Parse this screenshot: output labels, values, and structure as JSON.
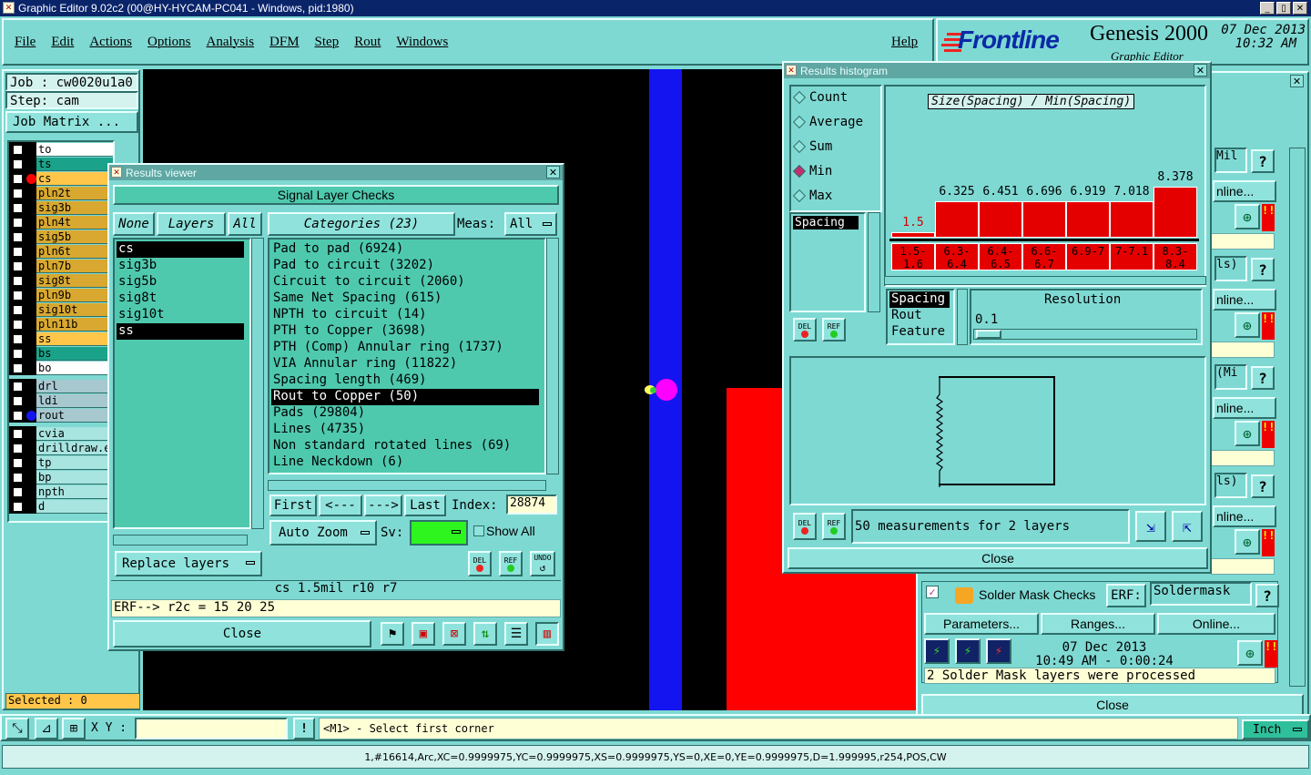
{
  "window": {
    "title": "Graphic Editor 9.02c2 (00@HY-HYCAM-PC041 - Windows, pid:1980)",
    "min": "_",
    "max": "▯",
    "close": "✕"
  },
  "menu": {
    "items": [
      "File",
      "Edit",
      "Actions",
      "Options",
      "Analysis",
      "DFM",
      "Step",
      "Rout",
      "Windows"
    ],
    "help": "Help"
  },
  "brand": {
    "logo": "Frontline",
    "product": "Genesis 2000",
    "subtitle": "Graphic Editor",
    "date": "07 Dec 2013",
    "time": "10:32 AM"
  },
  "job": {
    "job_label": "Job : cw0020u1a0",
    "step_label": "Step: cam",
    "matrix_button": "Job Matrix ..."
  },
  "layers": [
    {
      "name": "to",
      "color": "#ffffff"
    },
    {
      "name": "ts",
      "color": "#1aa38a"
    },
    {
      "name": "cs",
      "color": "#ffc64a"
    },
    {
      "name": "pln2t",
      "color": "#d8a830"
    },
    {
      "name": "sig3b",
      "color": "#d8a830"
    },
    {
      "name": "pln4t",
      "color": "#d8a830"
    },
    {
      "name": "sig5b",
      "color": "#d8a830"
    },
    {
      "name": "pln6t",
      "color": "#d8a830"
    },
    {
      "name": "pln7b",
      "color": "#d8a830"
    },
    {
      "name": "sig8t",
      "color": "#d8a830"
    },
    {
      "name": "pln9b",
      "color": "#d8a830"
    },
    {
      "name": "sig10t",
      "color": "#d8a830"
    },
    {
      "name": "pln11b",
      "color": "#d8a830"
    },
    {
      "name": "ss",
      "color": "#ffc64a"
    },
    {
      "name": "bs",
      "color": "#1aa38a"
    },
    {
      "name": "bo",
      "color": "#ffffff"
    },
    {
      "name": "drl",
      "color": "#a8c8d0"
    },
    {
      "name": "ldi",
      "color": "#a8c8d0"
    },
    {
      "name": "rout",
      "color": "#a8c8d0"
    },
    {
      "name": "cvia",
      "color": "#a8e4e0"
    },
    {
      "name": "drilldraw.e",
      "color": "#a8e4e0"
    },
    {
      "name": "tp",
      "color": "#a8e4e0"
    },
    {
      "name": "bp",
      "color": "#a8e4e0"
    },
    {
      "name": "npth",
      "color": "#a8e4e0"
    },
    {
      "name": "d",
      "color": "#a8e4e0"
    }
  ],
  "selected_label": "Selected : 0",
  "results_viewer": {
    "title": "Results viewer",
    "header": "Signal Layer Checks",
    "none_btn": "None",
    "layers_btn": "Layers",
    "all_btn": "All",
    "categories_btn": "Categories (23)",
    "meas_label": "Meas:",
    "meas_value": "All",
    "layers": [
      "cs",
      "sig3b",
      "sig5b",
      "sig8t",
      "sig10t",
      "ss"
    ],
    "categories": [
      "Pad to pad (6924)",
      "Pad to circuit (3202)",
      "Circuit to circuit (2060)",
      "Same Net Spacing (615)",
      "NPTH to circuit (14)",
      "PTH to Copper (3698)",
      "PTH (Comp) Annular ring (1737)",
      "VIA Annular ring (11822)",
      "Spacing length (469)",
      "Rout to Copper (50)",
      "Pads (29804)",
      "Lines (4735)",
      "Non standard rotated lines (69)",
      "Line Neckdown (6)"
    ],
    "selected_category_index": 9,
    "first": "First",
    "prev": "<---",
    "next": "--->",
    "last": "Last",
    "index_label": "Index:",
    "index_value": "28874",
    "auto_zoom": "Auto Zoom",
    "sv_label": "Sv:",
    "show_all": "Show All",
    "replace_layers": "Replace layers",
    "del": "DEL",
    "ref": "REF",
    "undo": "UNDO",
    "info": "cs 1.5mil  r10  r7",
    "erf": "ERF--> r2c = 15 20 25",
    "close": "Close"
  },
  "histogram": {
    "title": "Results histogram",
    "modes": [
      "Count",
      "Average",
      "Sum",
      "Min",
      "Max"
    ],
    "selected_mode": "Min",
    "chart_title": "Size(Spacing) / Min(Spacing)",
    "list_item": "Spacing",
    "bars": [
      {
        "value": "1.5",
        "range": "1.5-1.6",
        "level": 0.08
      },
      {
        "value": "6.325",
        "range": "6.3-6.4",
        "level": 0.72
      },
      {
        "value": "6.451",
        "range": "6.4-6.5",
        "level": 0.72
      },
      {
        "value": "6.696",
        "range": "6.6-6.7",
        "level": 0.72
      },
      {
        "value": "6.919",
        "range": "6.9-7",
        "level": 0.72
      },
      {
        "value": "7.018",
        "range": "7-7.1",
        "level": 0.72
      },
      {
        "value": "8.378",
        "range": "8.3-8.4",
        "level": 1.0
      }
    ],
    "types": [
      "Spacing",
      "Rout",
      "Feature"
    ],
    "resolution_label": "Resolution",
    "resolution_value": "0.1",
    "status": "50 measurements for 2 layers",
    "del": "DEL",
    "ref": "REF",
    "close": "Close"
  },
  "checks_panel": {
    "rows": [
      {
        "top": "Mil",
        "mid": "nline..."
      },
      {
        "top": "ls)",
        "mid": "nline..."
      },
      {
        "top": "(Mi",
        "mid": "nline..."
      },
      {
        "top": "ls)",
        "mid": "nline..."
      }
    ],
    "solder": {
      "name": "Solder Mask Checks",
      "erf_label": "ERF:",
      "erf_value": "Soldermask",
      "params": "Parameters...",
      "ranges": "Ranges...",
      "online": "Online...",
      "date": "07 Dec 2013",
      "time": "10:49 AM - 0:00:24",
      "result": "2 Solder Mask layers were processed"
    },
    "close": "Close",
    "help": "?"
  },
  "bottom": {
    "xy_label": "X Y :",
    "xy_value": "",
    "prompt": "<M1> - Select first corner",
    "units": "Inch",
    "status_line": "1,#16614,Arc,XC=0.9999975,YC=0.9999975,XS=0.9999975,YS=0,XE=0,YE=0.9999975,D=1.999995,r254,POS,CW"
  }
}
